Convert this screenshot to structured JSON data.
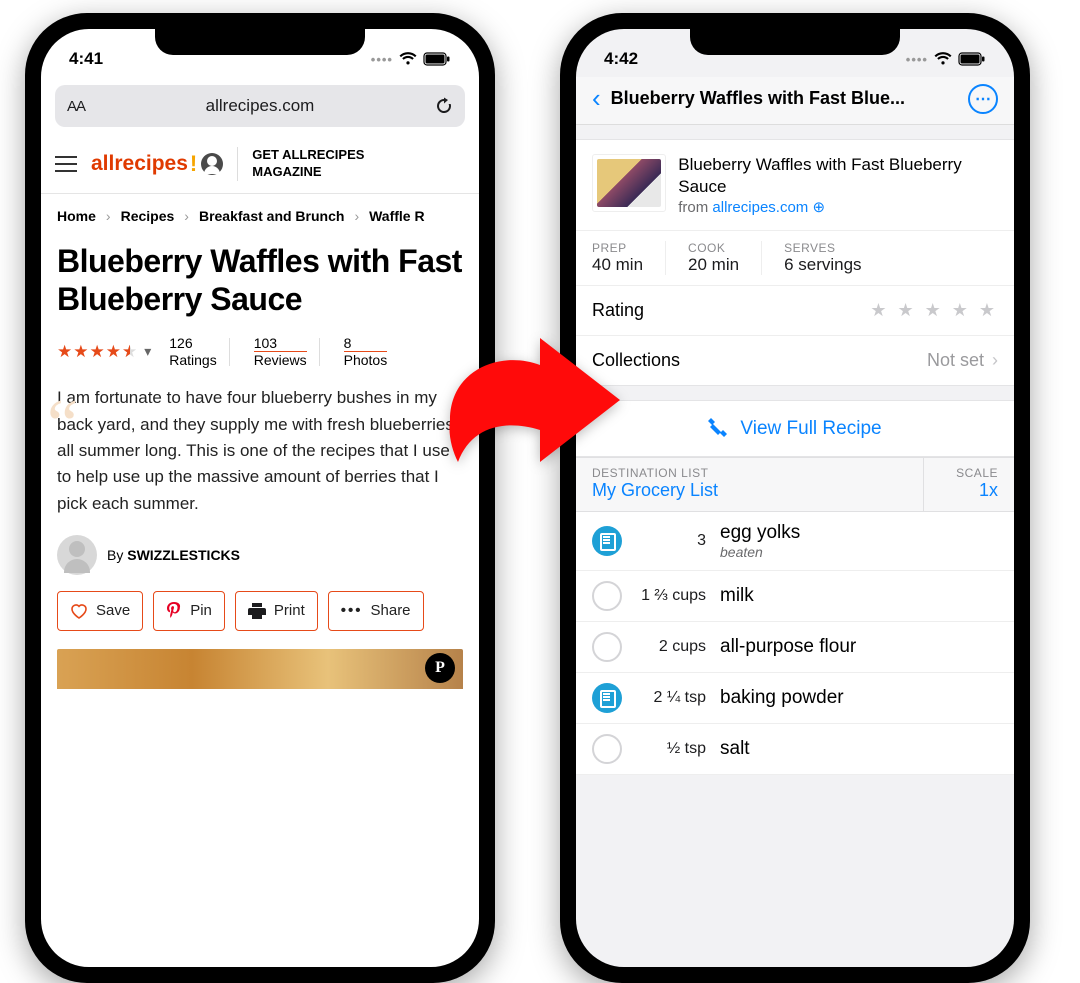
{
  "left": {
    "status_time": "4:41",
    "url": "allrecipes.com",
    "brand": "allrecipes",
    "magazine_cta_line1": "GET ALLRECIPES",
    "magazine_cta_line2": "MAGAZINE",
    "breadcrumbs": [
      "Home",
      "Recipes",
      "Breakfast and Brunch",
      "Waffle R"
    ],
    "title": "Blueberry Waffles with Fast Blueberry Sauce",
    "stars": "★★★★½",
    "ratings_count": "126",
    "ratings_label": "Ratings",
    "reviews_count": "103",
    "reviews_label": "Reviews",
    "photos_count": "8",
    "photos_label": "Photos",
    "description": "I am fortunate to have four blueberry bushes in my back yard, and they supply me with fresh blueberries all summer long. This is one of the recipes that I use to help use up the massive amount of berries that I pick each summer.",
    "author_by": "By ",
    "author_name": "SWIZZLESTICKS",
    "actions": {
      "save": "Save",
      "pin": "Pin",
      "print": "Print",
      "share": "Share"
    }
  },
  "right": {
    "status_time": "4:42",
    "header_title": "Blueberry Waffles with Fast Blue...",
    "recipe_title": "Blueberry Waffles with Fast Blueberry Sauce",
    "from_label": "from ",
    "source_domain": "allrecipes.com",
    "stats": {
      "prep_label": "PREP",
      "prep_value": "40 min",
      "cook_label": "COOK",
      "cook_value": "20 min",
      "serves_label": "SERVES",
      "serves_value": "6 servings"
    },
    "rating_label": "Rating",
    "collections_label": "Collections",
    "collections_value": "Not set",
    "view_full": "View Full Recipe",
    "dest_label": "DESTINATION LIST",
    "dest_value": "My Grocery List",
    "scale_label": "SCALE",
    "scale_value": "1x",
    "ingredients": [
      {
        "checked": true,
        "qty": "3",
        "name": "egg yolks",
        "note": "beaten"
      },
      {
        "checked": false,
        "qty": "1 ⅔ cups",
        "name": "milk"
      },
      {
        "checked": false,
        "qty": "2 cups",
        "name": "all-purpose flour"
      },
      {
        "checked": true,
        "qty": "2 ¼ tsp",
        "name": "baking powder"
      },
      {
        "checked": false,
        "qty": "½ tsp",
        "name": "salt"
      }
    ]
  }
}
